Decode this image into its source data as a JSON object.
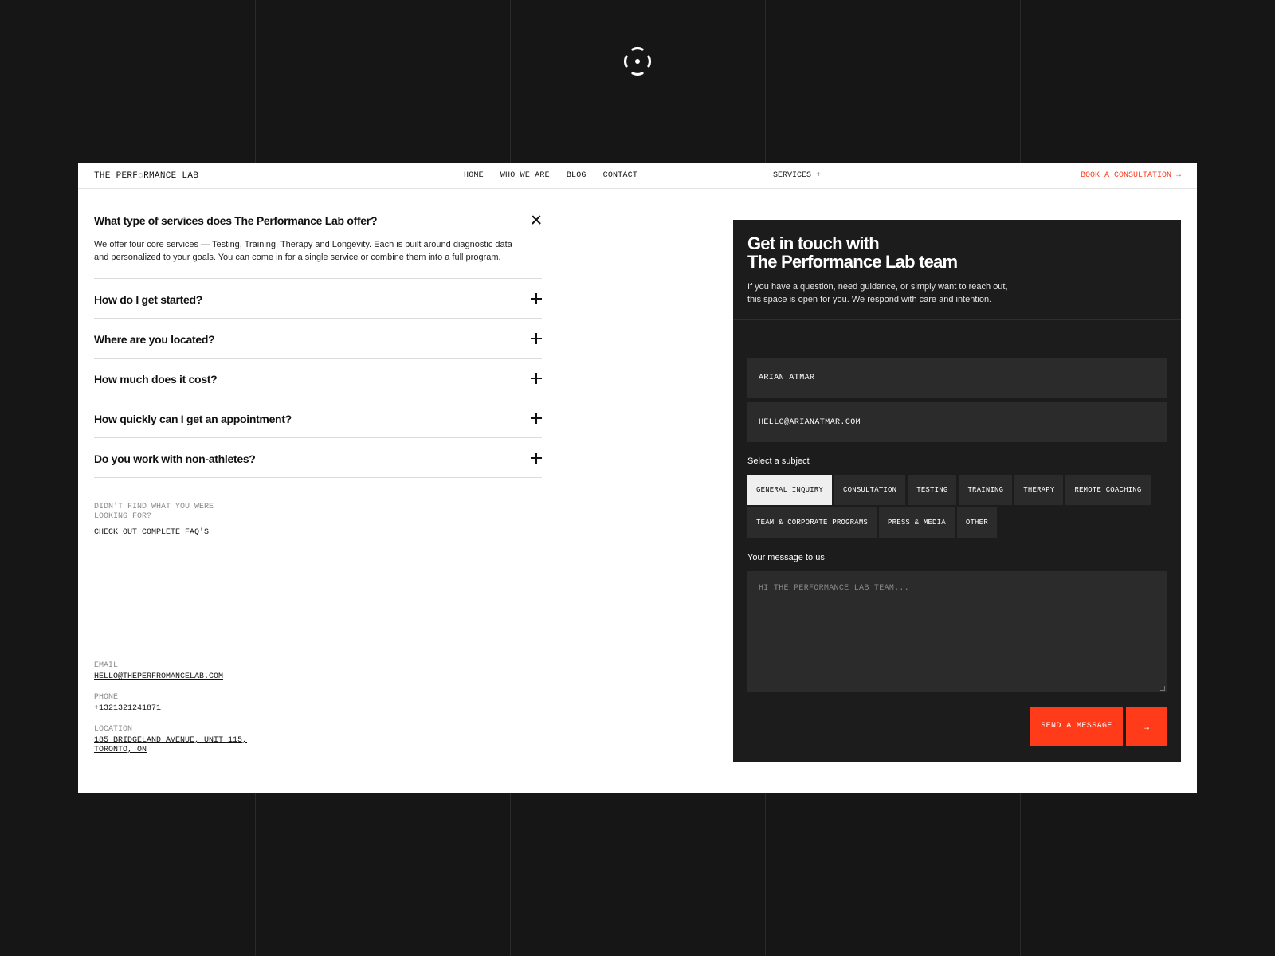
{
  "nav": {
    "brand": "THE PERF◌RMANCE LAB",
    "links": [
      "HOME",
      "WHO WE ARE",
      "BLOG",
      "CONTACT"
    ],
    "services": "SERVICES +",
    "cta": "BOOK A CONSULTATION →"
  },
  "faq": {
    "open_question": "What type of services does The Performance Lab offer?",
    "open_answer": "We offer four core services — Testing, Training, Therapy and Longevity. Each is built around diagnostic data and personalized to your goals. You can come in for a single service or combine them into a full program.",
    "items": [
      "How do I get started?",
      "Where are you located?",
      "How much does it cost?",
      "How quickly can I get an appointment?",
      "Do you work with non-athletes?"
    ],
    "more_label": "DIDN'T FIND WHAT YOU WERE LOOKING FOR?",
    "more_link": "CHECK OUT COMPLETE FAQ'S"
  },
  "contact": {
    "email_label": "EMAIL",
    "email": "HELLO@THEPERFROMANCELAB.COM",
    "phone_label": "PHONE",
    "phone": "+1321321241871",
    "location_label": "LOCATION",
    "location": "185 BRIDGELAND AVENUE, UNIT 115, TORONTO, ON"
  },
  "form": {
    "title_line1": "Get in touch with",
    "title_line2": "The Performance Lab team",
    "subtitle": "If you have a question, need guidance, or simply want to reach out, this space is open for you. We respond with care and intention.",
    "name_value": "ARIAN ATMAR",
    "email_value": "HELLO@ARIANATMAR.COM",
    "subject_label": "Select a subject",
    "subjects": [
      "GENERAL INQUIRY",
      "CONSULTATION",
      "TESTING",
      "TRAINING",
      "THERAPY",
      "REMOTE COACHING",
      "TEAM & CORPORATE PROGRAMS",
      "PRESS & MEDIA",
      "OTHER"
    ],
    "selected_subject": "GENERAL INQUIRY",
    "message_label": "Your message to us",
    "message_placeholder": "HI THE PERFORMANCE LAB TEAM...",
    "send_label": "SEND A MESSAGE",
    "send_arrow": "→"
  },
  "colors": {
    "background": "#161616",
    "accent": "#ff3b1a",
    "card": "#1c1c1c",
    "field": "#2b2b2b"
  },
  "icons": {
    "top_logo": "performance-lab-logo-icon",
    "faq_open": "close-icon",
    "faq_closed": "plus-icon",
    "send": "arrow-right-icon"
  }
}
